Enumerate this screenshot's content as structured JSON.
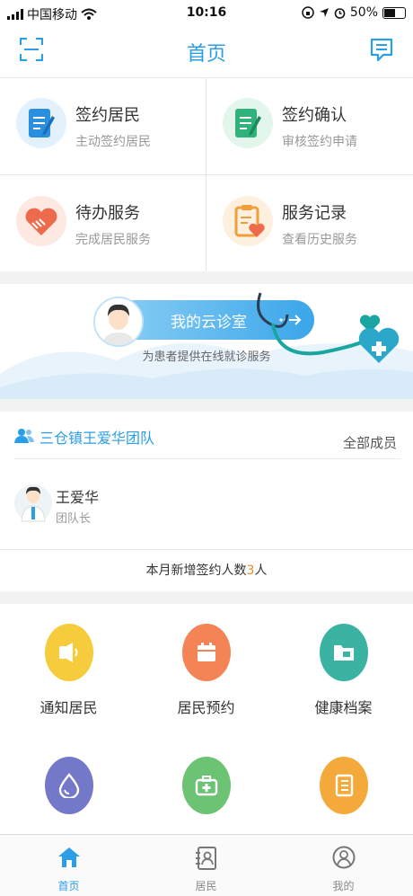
{
  "status_bar": {
    "carrier": "中国移动",
    "time": "10:16",
    "battery": "50%"
  },
  "nav": {
    "title": "首页",
    "left_icon": "scan-icon",
    "right_icon": "message-icon"
  },
  "cards": [
    {
      "title": "签约居民",
      "subtitle": "主动签约居民",
      "icon": "sign-document-icon",
      "color": "#2b8fe0"
    },
    {
      "title": "签约确认",
      "subtitle": "审核签约申请",
      "icon": "confirm-document-icon",
      "color": "#2fb37a"
    },
    {
      "title": "待办服务",
      "subtitle": "完成居民服务",
      "icon": "handshake-heart-icon",
      "color": "#ee6a4c"
    },
    {
      "title": "服务记录",
      "subtitle": "查看历史服务",
      "icon": "clipboard-heart-icon",
      "color": "#f0a03a"
    }
  ],
  "banner": {
    "title": "我的云诊室",
    "subtitle": "为患者提供在线就诊服务"
  },
  "team": {
    "name": "三仓镇王爱华团队",
    "all_members_label": "全部成员",
    "member": {
      "name": "王爱华",
      "role": "团队长"
    },
    "stat_prefix": "本月新增签约人数",
    "stat_number": "3",
    "stat_suffix": "人"
  },
  "features": [
    {
      "label": "通知居民",
      "icon": "speaker-icon",
      "color": "#f6cc3c"
    },
    {
      "label": "居民预约",
      "icon": "calendar-icon",
      "color": "#f48456"
    },
    {
      "label": "健康档案",
      "icon": "folder-icon",
      "color": "#3bb3a3"
    },
    {
      "label": "",
      "icon": "water-drop-icon",
      "color": "#7478c9"
    },
    {
      "label": "",
      "icon": "medical-kit-icon",
      "color": "#6cc373"
    },
    {
      "label": "",
      "icon": "notebook-icon",
      "color": "#f4a93b"
    }
  ],
  "tabs": [
    {
      "label": "首页",
      "icon": "home-icon",
      "active": true
    },
    {
      "label": "居民",
      "icon": "contacts-icon",
      "active": false
    },
    {
      "label": "我的",
      "icon": "user-icon",
      "active": false
    }
  ],
  "accent": "#2a9ee6",
  "highlight": "#f08a24"
}
